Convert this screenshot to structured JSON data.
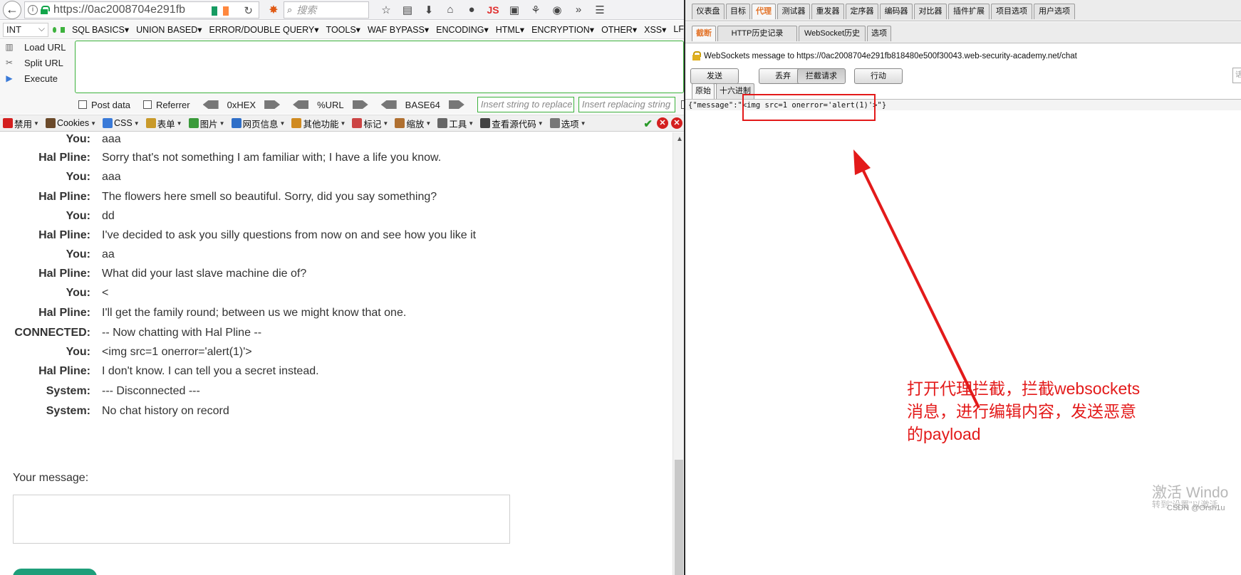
{
  "browser": {
    "url": "https://0ac2008704e291fb",
    "search_placeholder": "搜索",
    "js_label": "JS",
    "overflow_label": "»"
  },
  "hackbar": {
    "select_value": "INT",
    "menus": [
      "SQL BASICS",
      "UNION BASED",
      "ERROR/DOUBLE QUERY",
      "TOOLS",
      "WAF BYPASS",
      "ENCODING",
      "HTML",
      "ENCRYPTION",
      "OTHER",
      "XSS",
      "LF"
    ],
    "load_url": "Load URL",
    "split_url": "Split URL",
    "execute": "Execute",
    "post_data": "Post data",
    "referrer": "Referrer",
    "hex": "0xHEX",
    "url_enc": "%URL",
    "base64": "BASE64",
    "replace_placeholder": "Insert string to replace",
    "replacing_placeholder": "Insert replacing string"
  },
  "devbar": {
    "items": [
      "禁用",
      "Cookies",
      "CSS",
      "表单",
      "图片",
      "网页信息",
      "其他功能",
      "标记",
      "缩放",
      "工具",
      "查看源代码",
      "选项"
    ]
  },
  "chat": {
    "messages": [
      {
        "who": "You:",
        "text": "aaa"
      },
      {
        "who": "Hal Pline:",
        "text": "Sorry that's not something I am familiar with; I have a life you know."
      },
      {
        "who": "You:",
        "text": "aaa"
      },
      {
        "who": "Hal Pline:",
        "text": "The flowers here smell so beautiful. Sorry, did you say something?"
      },
      {
        "who": "You:",
        "text": "dd"
      },
      {
        "who": "Hal Pline:",
        "text": "I've decided to ask you silly questions from now on and see how you like it"
      },
      {
        "who": "You:",
        "text": "aa"
      },
      {
        "who": "Hal Pline:",
        "text": "What did your last slave machine die of?"
      },
      {
        "who": "You:",
        "text": "<"
      },
      {
        "who": "Hal Pline:",
        "text": "I'll get the family round; between us we might know that one."
      },
      {
        "who": "CONNECTED:",
        "text": "-- Now chatting with Hal Pline --"
      },
      {
        "who": "You:",
        "text": "<img src=1 onerror='alert(1)'>"
      },
      {
        "who": "Hal Pline:",
        "text": "I don't know. I can tell you a secret instead."
      },
      {
        "who": "System:",
        "text": "--- Disconnected ---"
      },
      {
        "who": "System:",
        "text": "No chat history on record"
      }
    ],
    "your_message_label": "Your message:"
  },
  "burp": {
    "tabs": [
      "仪表盘",
      "目标",
      "代理",
      "测试器",
      "重发器",
      "定序器",
      "编码器",
      "对比器",
      "插件扩展",
      "项目选项",
      "用户选项"
    ],
    "active_tab": "代理",
    "sub_tabs": [
      "截断",
      "HTTP历史记录",
      "WebSocket历史",
      "选项"
    ],
    "active_sub_tab": "截断",
    "ws_info": "WebSockets message to https://0ac2008704e291fb818480e500f30043.web-security-academy.net/chat",
    "buttons": [
      "发送",
      "丢弃",
      "拦截请求",
      "行动"
    ],
    "pressed_button": "拦截请求",
    "search_clip": "话",
    "view_tabs": [
      "原始",
      "十六进制"
    ],
    "active_view_tab": "原始",
    "message_body": "{\"message\":\"<img src=1 onerror='alert(1)'>\"}"
  },
  "annotation": {
    "lines": [
      "打开代理拦截，拦截websockets",
      "消息，进行编辑内容，发送恶意",
      "的payload"
    ]
  },
  "watermark": {
    "text": "激活 Windo",
    "sub": "转到\"设置\"以激活",
    "csdn": "CSDN @Orsh1u"
  },
  "colors": {
    "annotation_red": "#e31a1a",
    "burp_orange": "#e3742a",
    "hackbar_green": "#3db23d",
    "send_button": "#1e9e7a"
  }
}
